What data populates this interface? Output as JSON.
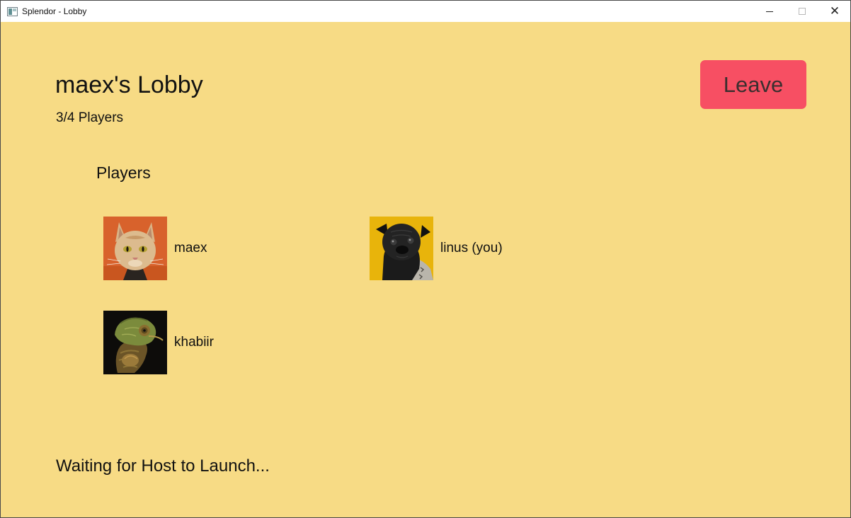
{
  "window": {
    "title": "Splendor - Lobby",
    "close_glyph": "✕"
  },
  "lobby": {
    "title": "maex's Lobby",
    "player_count": "3/4 Players",
    "leave_label": "Leave",
    "players_heading": "Players",
    "waiting_text": "Waiting for Host to Launch..."
  },
  "players": [
    {
      "name": "maex",
      "avatar": "cat-avatar"
    },
    {
      "name": "linus (you)",
      "avatar": "pug-avatar"
    },
    {
      "name": "khabiir",
      "avatar": "chameleon-avatar"
    }
  ],
  "colors": {
    "background": "#f7db85",
    "leave_button": "#f74f63"
  }
}
